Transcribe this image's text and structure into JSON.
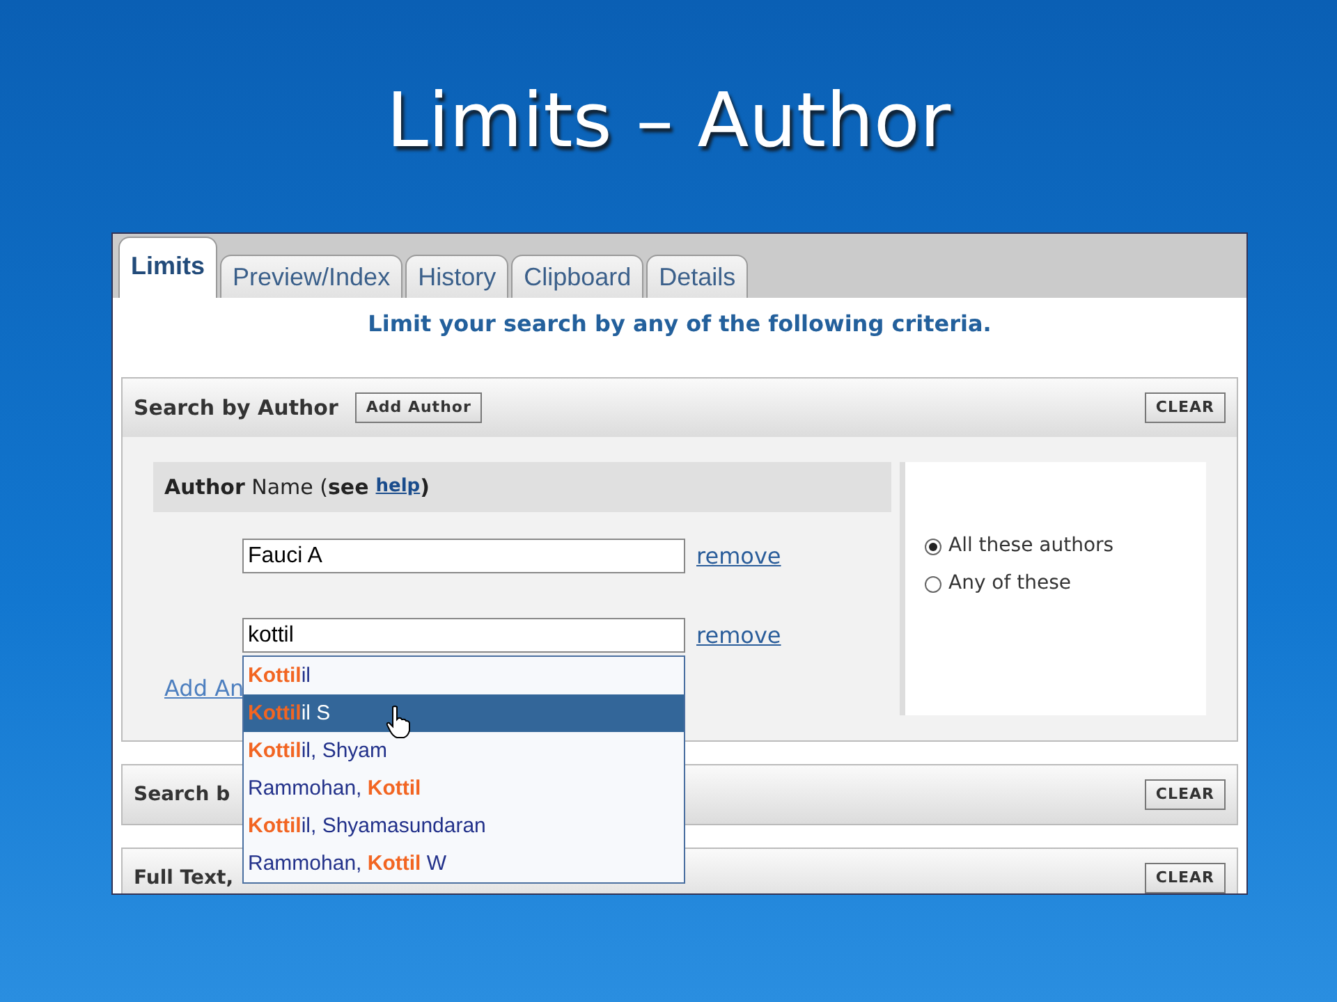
{
  "slide_title": "Limits – Author",
  "tabs": [
    {
      "label": "Limits",
      "selected": true
    },
    {
      "label": "Preview/Index",
      "selected": false
    },
    {
      "label": "History",
      "selected": false
    },
    {
      "label": "Clipboard",
      "selected": false
    },
    {
      "label": "Details",
      "selected": false
    }
  ],
  "intro": "Limit your search by any of the following criteria.",
  "author_section": {
    "title": "Search by Author",
    "add_button": "Add Author",
    "clear_button": "CLEAR",
    "heading": "**Author** Name (**see** ",
    "help_link": "help",
    "heading_end": ")",
    "authors": [
      {
        "value": "Fauci A",
        "remove": "remove"
      },
      {
        "value": "kottil",
        "remove": "remove"
      }
    ],
    "add_another": "Add An",
    "options": [
      {
        "label": "All these authors",
        "selected": true
      },
      {
        "label": "Any of these",
        "selected": false
      }
    ]
  },
  "suggestions": [
    {
      "text": "**Kottil**il",
      "selected": false
    },
    {
      "text": "**Kottil**il S",
      "selected": true
    },
    {
      "text": "**Kottil**il, Shyam",
      "selected": false
    },
    {
      "text": "Rammohan, **Kottil**",
      "selected": false
    },
    {
      "text": "**Kottil**il, Shyamasundaran",
      "selected": false
    },
    {
      "text": "Rammohan, **Kottil** W",
      "selected": false
    }
  ],
  "sections": [
    {
      "title": "Search b",
      "clear_button": "CLEAR"
    },
    {
      "title": "Full Text,",
      "clear_button": "CLEAR"
    }
  ]
}
